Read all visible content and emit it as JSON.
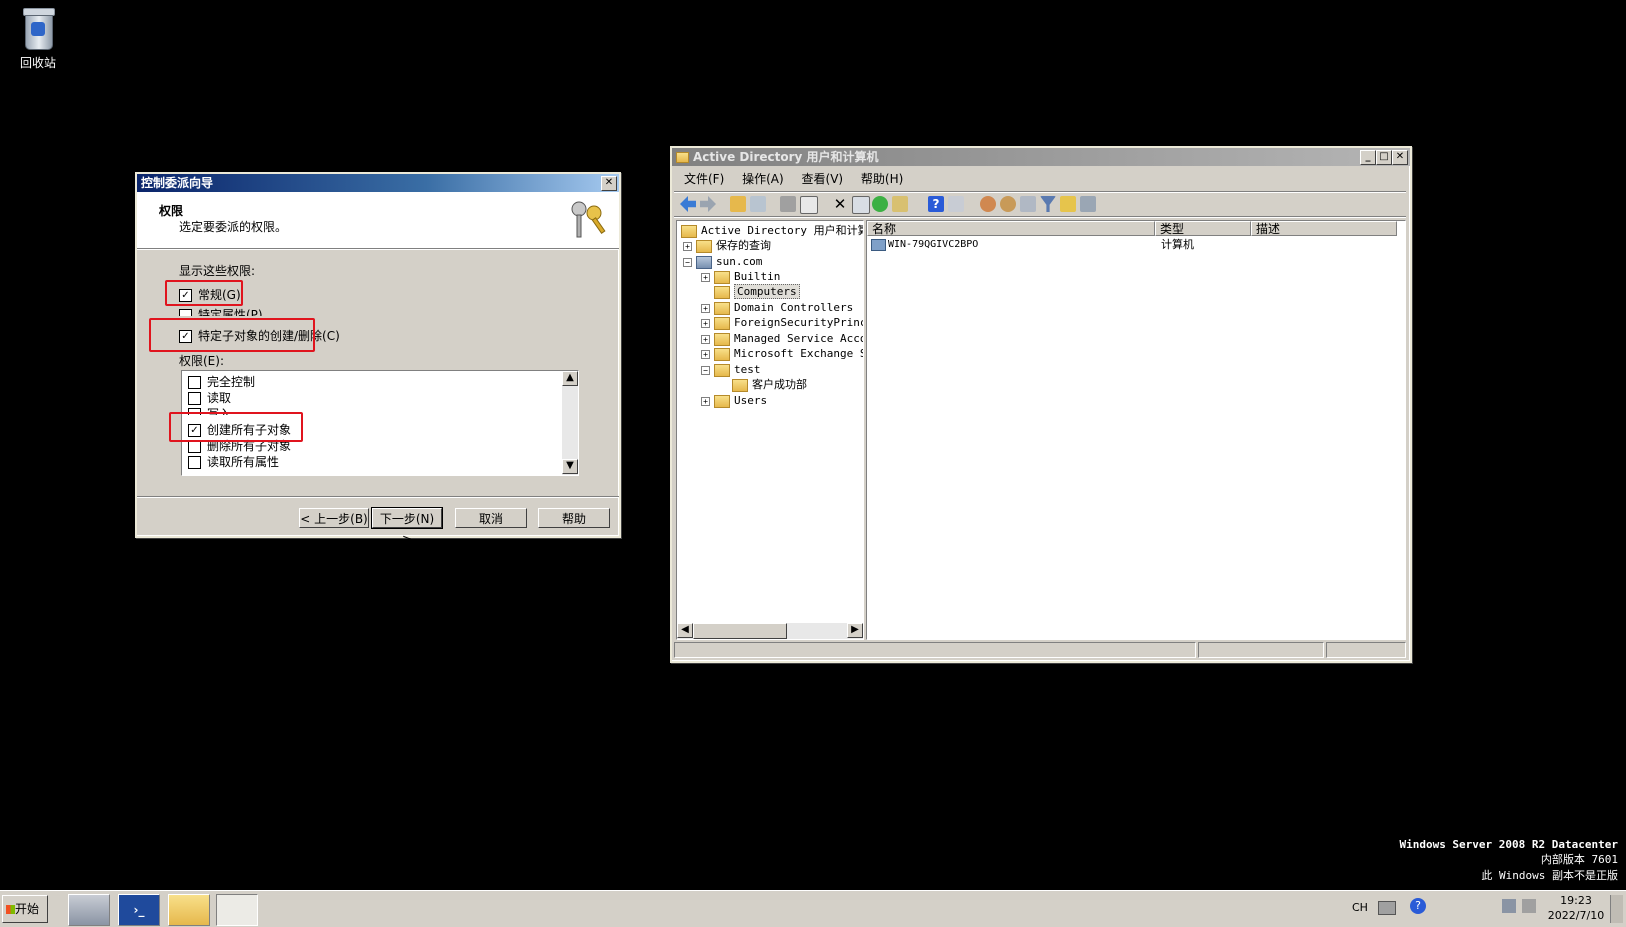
{
  "desktop": {
    "recycle_bin_label": "回收站",
    "watermark": [
      "Windows Server 2008 R2 Datacenter",
      "内部版本 7601",
      "此 Windows 副本不是正版"
    ]
  },
  "wizard": {
    "title": "控制委派向导",
    "header_title": "权限",
    "header_subtitle": "选定要委派的权限。",
    "show_label": "显示这些权限:",
    "show_options": [
      {
        "label": "常规(G)",
        "checked": true
      },
      {
        "label": "特定属性(P)",
        "checked": false
      },
      {
        "label": "特定子对象的创建/删除(C)",
        "checked": true
      }
    ],
    "perm_label": "权限(E):",
    "permissions": [
      {
        "label": "完全控制",
        "checked": false
      },
      {
        "label": "读取",
        "checked": false
      },
      {
        "label": "写入",
        "checked": false
      },
      {
        "label": "创建所有子对象",
        "checked": true
      },
      {
        "label": "删除所有子对象",
        "checked": false
      },
      {
        "label": "读取所有属性",
        "checked": false
      }
    ],
    "buttons": {
      "back": "< 上一步(B)",
      "next": "下一步(N) >",
      "cancel": "取消",
      "help": "帮助"
    },
    "close_glyph": "✕"
  },
  "ad": {
    "title": "Active Directory 用户和计算机",
    "menu": [
      "文件(F)",
      "操作(A)",
      "查看(V)",
      "帮助(H)"
    ],
    "tree_root": "Active Directory 用户和计算机",
    "tree": [
      {
        "label": "保存的查询",
        "pm": "+"
      },
      {
        "label": "sun.com",
        "pm": "−"
      },
      {
        "label": "Builtin",
        "pm": "+"
      },
      {
        "label": "Computers",
        "pm": ""
      },
      {
        "label": "Domain Controllers",
        "pm": "+"
      },
      {
        "label": "ForeignSecurityPrincip",
        "pm": "+"
      },
      {
        "label": "Managed Service Accour",
        "pm": "+"
      },
      {
        "label": "Microsoft Exchange Sec",
        "pm": "+"
      },
      {
        "label": "test",
        "pm": "−"
      },
      {
        "label": "客户成功部",
        "pm": ""
      },
      {
        "label": "Users",
        "pm": "+"
      }
    ],
    "columns": [
      "名称",
      "类型",
      "描述"
    ],
    "rows": [
      {
        "name": "WIN-79QGIVC2BPO",
        "type": "计算机",
        "desc": ""
      }
    ]
  },
  "taskbar": {
    "start": "开始",
    "lang": "CH",
    "time": "19:23",
    "date": "2022/7/10"
  }
}
